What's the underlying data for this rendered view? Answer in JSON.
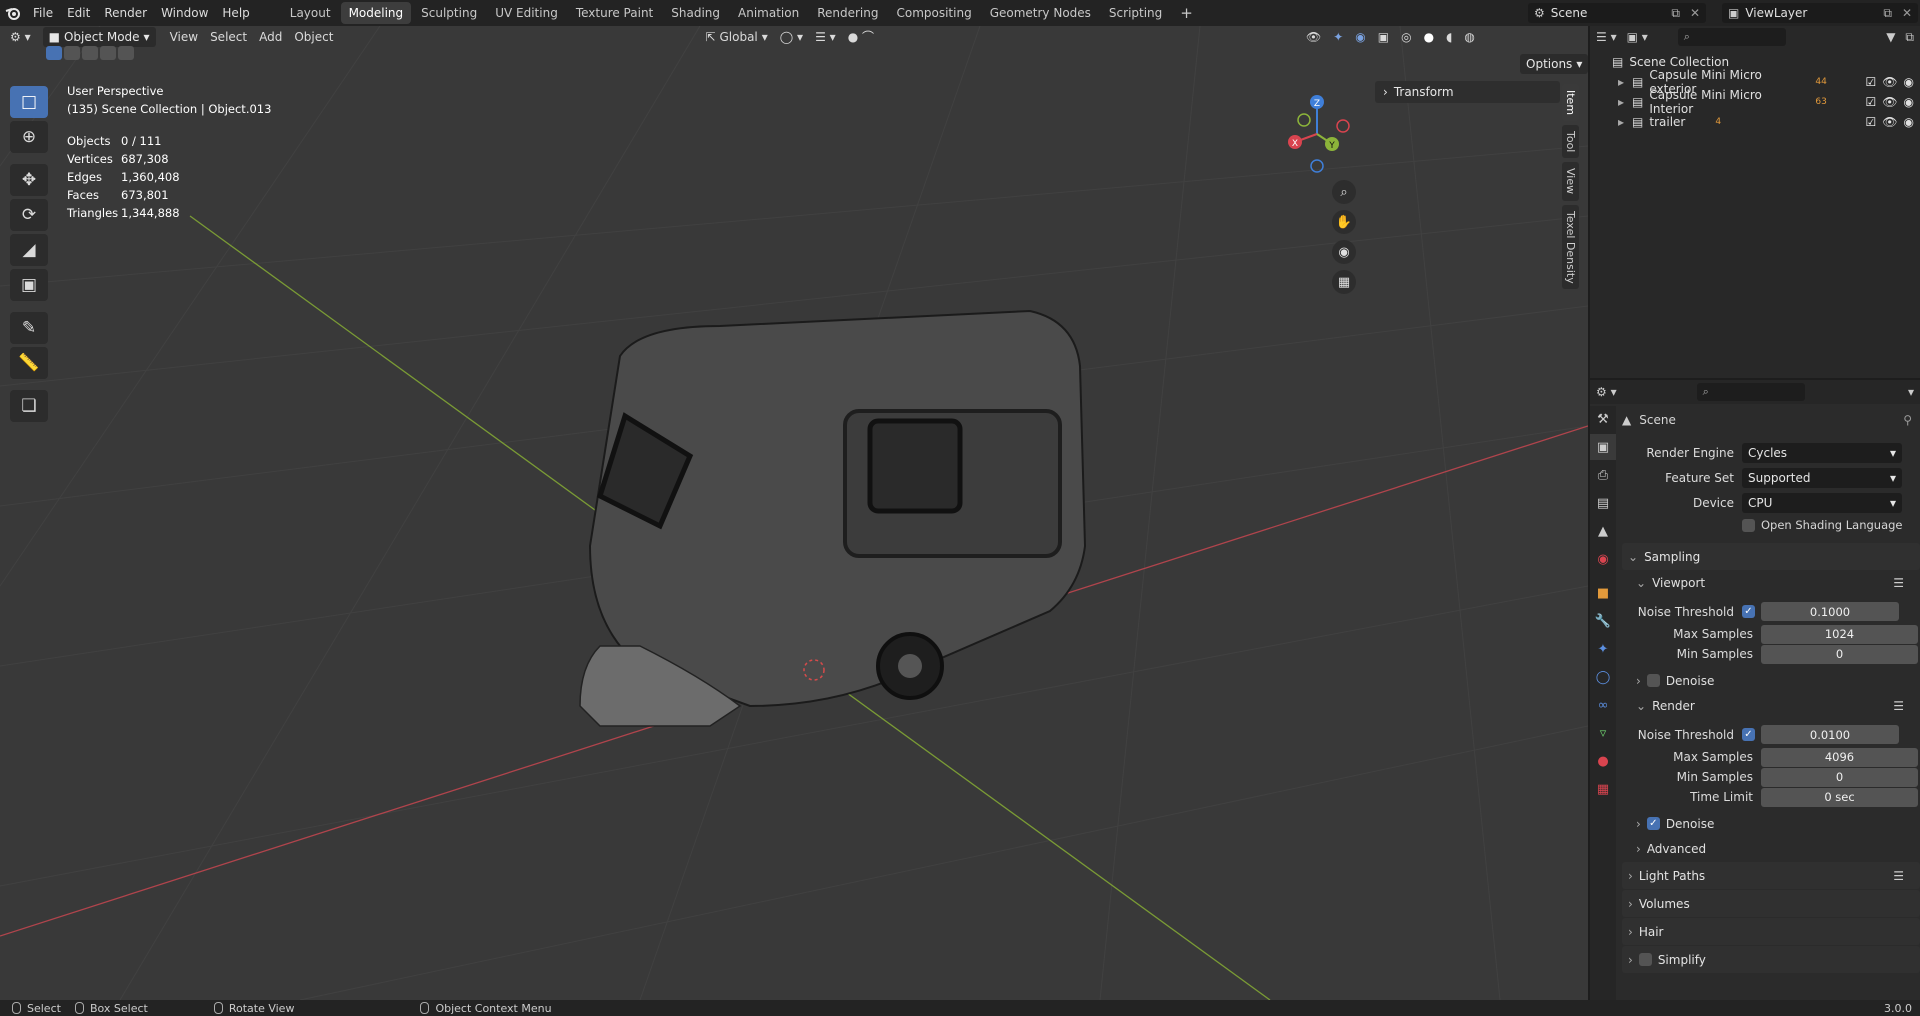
{
  "app": {
    "menus": [
      "File",
      "Edit",
      "Render",
      "Window",
      "Help"
    ],
    "workspaces": [
      "Layout",
      "Modeling",
      "Sculpting",
      "UV Editing",
      "Texture Paint",
      "Shading",
      "Animation",
      "Rendering",
      "Compositing",
      "Geometry Nodes",
      "Scripting"
    ],
    "active_workspace": "Modeling",
    "scene_name": "Scene",
    "view_layer": "ViewLayer",
    "plus_glyph": "+"
  },
  "viewport": {
    "mode": "Object Mode",
    "menus": [
      "View",
      "Select",
      "Add",
      "Object"
    ],
    "transform_orientation": "Global",
    "options_label": "Options",
    "perspective_label": "User Perspective",
    "collection_label": "(135) Scene Collection | Object.013",
    "stats": [
      {
        "label": "Objects",
        "value": "0 / 111"
      },
      {
        "label": "Vertices",
        "value": "687,308"
      },
      {
        "label": "Edges",
        "value": "1,360,408"
      },
      {
        "label": "Faces",
        "value": "673,801"
      },
      {
        "label": "Triangles",
        "value": "1,344,888"
      }
    ],
    "gizmo_axes": {
      "x": "X",
      "y": "Y",
      "z": "Z"
    },
    "transform_panel": "Transform",
    "side_tabs": [
      "Item",
      "Tool",
      "View",
      "Texel Density"
    ]
  },
  "outliner": {
    "root": "Scene Collection",
    "items": [
      {
        "label": "Capsule Mini Micro  exterior",
        "badge": "44"
      },
      {
        "label": "Capsule Mini Micro  Interior",
        "badge": "63"
      },
      {
        "label": "trailer",
        "badge": "4"
      }
    ]
  },
  "properties": {
    "context": "Scene",
    "render_engine_label": "Render Engine",
    "render_engine": "Cycles",
    "feature_set_label": "Feature Set",
    "feature_set": "Supported",
    "device_label": "Device",
    "device": "CPU",
    "osl_label": "Open Shading Language",
    "sampling": {
      "title": "Sampling",
      "viewport": {
        "title": "Viewport",
        "noise_threshold_label": "Noise Threshold",
        "noise_threshold": "0.1000",
        "max_samples_label": "Max Samples",
        "max_samples": "1024",
        "min_samples_label": "Min Samples",
        "min_samples": "0",
        "denoise_label": "Denoise"
      },
      "render": {
        "title": "Render",
        "noise_threshold_label": "Noise Threshold",
        "noise_threshold": "0.0100",
        "max_samples_label": "Max Samples",
        "max_samples": "4096",
        "min_samples_label": "Min Samples",
        "min_samples": "0",
        "time_limit_label": "Time Limit",
        "time_limit": "0 sec",
        "denoise_label": "Denoise"
      },
      "advanced_label": "Advanced"
    },
    "sections": [
      "Light Paths",
      "Volumes",
      "Hair",
      "Simplify"
    ]
  },
  "statusbar": {
    "select": "Select",
    "box_select": "Box Select",
    "rotate_view": "Rotate View",
    "context_menu": "Object Context Menu",
    "version": "3.0.0"
  },
  "colors": {
    "accent": "#4772b3",
    "viewport_bg": "#393939",
    "x_axis": "#d9444f",
    "y_axis": "#8cb43a",
    "z_axis": "#3f7fd9"
  }
}
